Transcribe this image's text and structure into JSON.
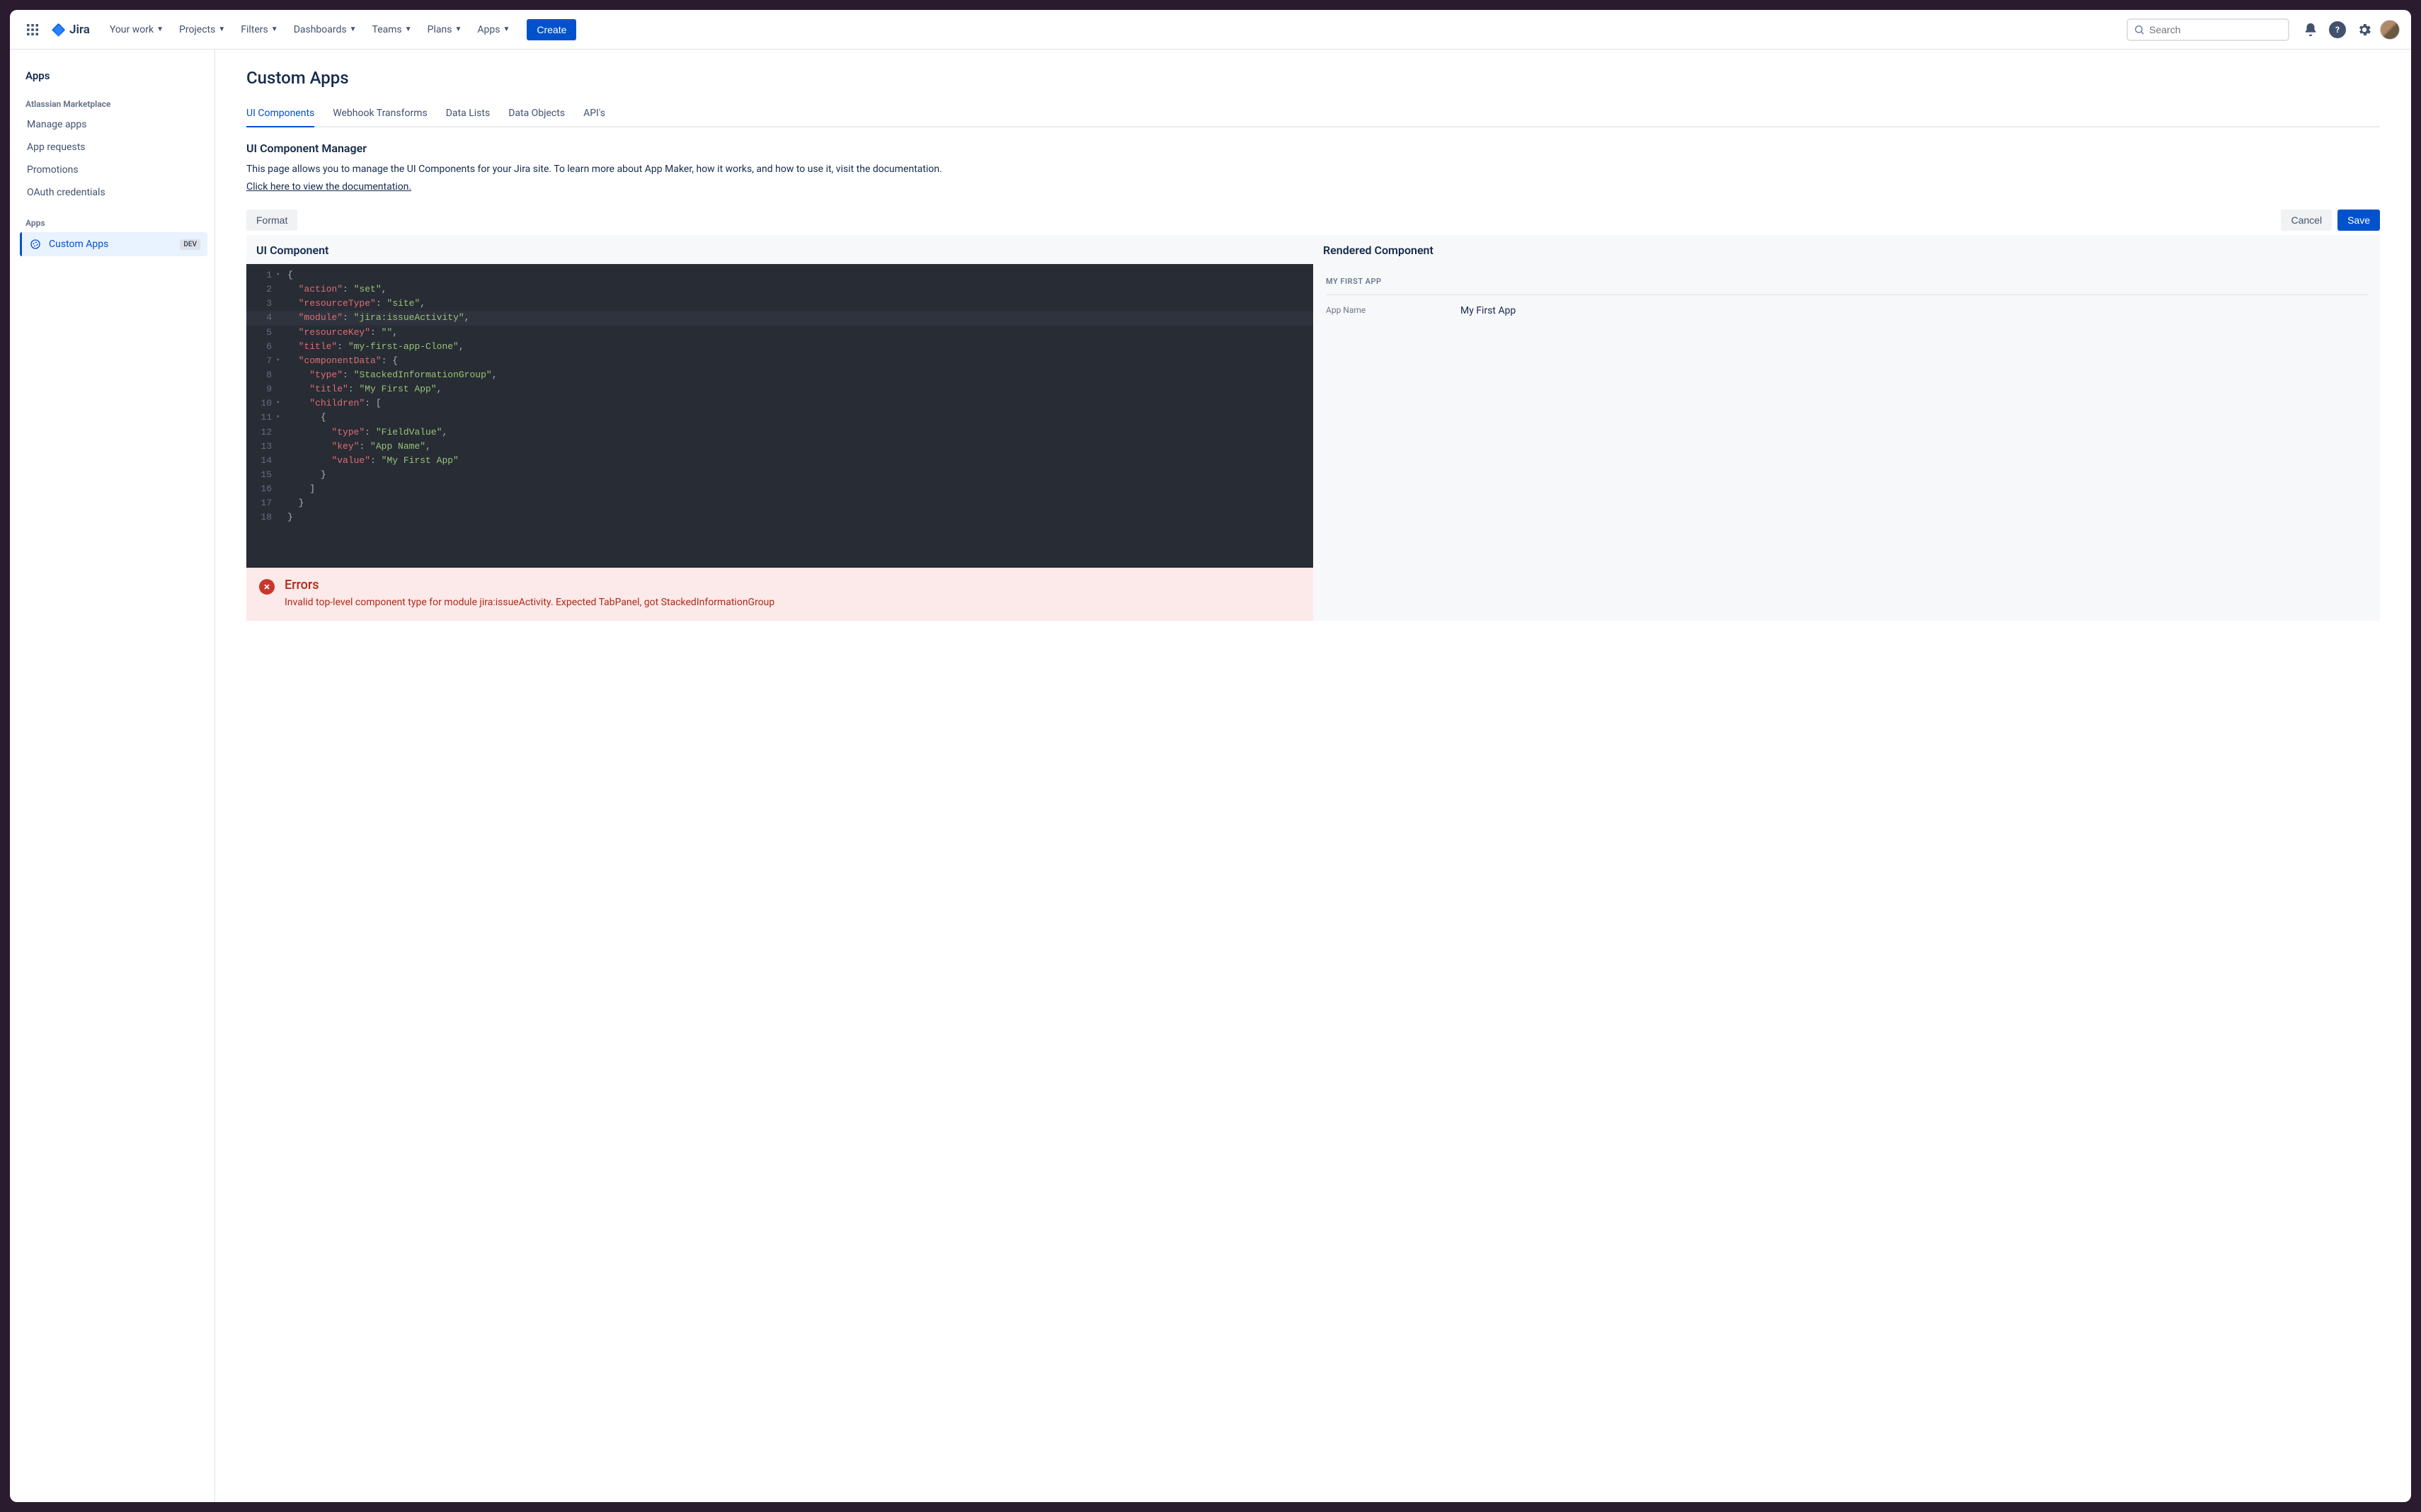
{
  "topnav": {
    "logo_text": "Jira",
    "items": [
      {
        "label": "Your work"
      },
      {
        "label": "Projects"
      },
      {
        "label": "Filters"
      },
      {
        "label": "Dashboards"
      },
      {
        "label": "Teams"
      },
      {
        "label": "Plans"
      },
      {
        "label": "Apps"
      }
    ],
    "create_label": "Create",
    "search_placeholder": "Search"
  },
  "sidebar": {
    "title": "Apps",
    "section1_label": "Atlassian Marketplace",
    "section1_items": [
      {
        "label": "Manage apps"
      },
      {
        "label": "App requests"
      },
      {
        "label": "Promotions"
      },
      {
        "label": "OAuth credentials"
      }
    ],
    "section2_label": "Apps",
    "active_item_label": "Custom Apps",
    "active_item_badge": "DEV"
  },
  "page": {
    "title": "Custom Apps",
    "tabs": [
      {
        "label": "UI Components",
        "active": true
      },
      {
        "label": "Webhook Transforms"
      },
      {
        "label": "Data Lists"
      },
      {
        "label": "Data Objects"
      },
      {
        "label": "API's"
      }
    ],
    "section_heading": "UI Component Manager",
    "description": "This page allows you to manage the UI Components for your Jira site. To learn more about App Maker, how it works, and how to use it, visit the documentation.",
    "doc_link_text": "Click here to view the documentation."
  },
  "toolbar": {
    "format_label": "Format",
    "cancel_label": "Cancel",
    "save_label": "Save"
  },
  "editor": {
    "panel_title": "UI Component",
    "code": {
      "action": "set",
      "resourceType": "site",
      "module": "jira:issueActivity",
      "resourceKey": "",
      "title": "my-first-app-Clone",
      "componentData": {
        "type": "StackedInformationGroup",
        "title": "My First App",
        "children": [
          {
            "type": "FieldValue",
            "key": "App Name",
            "value": "My First App"
          }
        ]
      }
    },
    "lines": [
      {
        "n": 1,
        "fold": true,
        "indent": 0,
        "tokens": [
          [
            "punc",
            "{"
          ]
        ]
      },
      {
        "n": 2,
        "fold": false,
        "indent": 1,
        "tokens": [
          [
            "key",
            "\"action\""
          ],
          [
            "punc",
            ": "
          ],
          [
            "str",
            "\"set\""
          ],
          [
            "punc",
            ","
          ]
        ]
      },
      {
        "n": 3,
        "fold": false,
        "indent": 1,
        "tokens": [
          [
            "key",
            "\"resourceType\""
          ],
          [
            "punc",
            ": "
          ],
          [
            "str",
            "\"site\""
          ],
          [
            "punc",
            ","
          ]
        ]
      },
      {
        "n": 4,
        "fold": false,
        "indent": 1,
        "hl": true,
        "tokens": [
          [
            "key",
            "\"module\""
          ],
          [
            "punc",
            ": "
          ],
          [
            "str",
            "\"jira:issueActivity\""
          ],
          [
            "punc",
            ","
          ]
        ]
      },
      {
        "n": 5,
        "fold": false,
        "indent": 1,
        "tokens": [
          [
            "key",
            "\"resourceKey\""
          ],
          [
            "punc",
            ": "
          ],
          [
            "str",
            "\"\""
          ],
          [
            "punc",
            ","
          ]
        ]
      },
      {
        "n": 6,
        "fold": false,
        "indent": 1,
        "tokens": [
          [
            "key",
            "\"title\""
          ],
          [
            "punc",
            ": "
          ],
          [
            "str",
            "\"my-first-app-Clone\""
          ],
          [
            "punc",
            ","
          ]
        ]
      },
      {
        "n": 7,
        "fold": true,
        "indent": 1,
        "tokens": [
          [
            "key",
            "\"componentData\""
          ],
          [
            "punc",
            ": {"
          ]
        ]
      },
      {
        "n": 8,
        "fold": false,
        "indent": 2,
        "tokens": [
          [
            "key",
            "\"type\""
          ],
          [
            "punc",
            ": "
          ],
          [
            "str",
            "\"StackedInformationGroup\""
          ],
          [
            "punc",
            ","
          ]
        ]
      },
      {
        "n": 9,
        "fold": false,
        "indent": 2,
        "tokens": [
          [
            "key",
            "\"title\""
          ],
          [
            "punc",
            ": "
          ],
          [
            "str",
            "\"My First App\""
          ],
          [
            "punc",
            ","
          ]
        ]
      },
      {
        "n": 10,
        "fold": true,
        "indent": 2,
        "tokens": [
          [
            "key",
            "\"children\""
          ],
          [
            "punc",
            ": ["
          ]
        ]
      },
      {
        "n": 11,
        "fold": true,
        "indent": 3,
        "tokens": [
          [
            "punc",
            "{"
          ]
        ]
      },
      {
        "n": 12,
        "fold": false,
        "indent": 4,
        "tokens": [
          [
            "key",
            "\"type\""
          ],
          [
            "punc",
            ": "
          ],
          [
            "str",
            "\"FieldValue\""
          ],
          [
            "punc",
            ","
          ]
        ]
      },
      {
        "n": 13,
        "fold": false,
        "indent": 4,
        "tokens": [
          [
            "key",
            "\"key\""
          ],
          [
            "punc",
            ": "
          ],
          [
            "str",
            "\"App Name\""
          ],
          [
            "punc",
            ","
          ]
        ]
      },
      {
        "n": 14,
        "fold": false,
        "indent": 4,
        "tokens": [
          [
            "key",
            "\"value\""
          ],
          [
            "punc",
            ": "
          ],
          [
            "str",
            "\"My First App\""
          ]
        ]
      },
      {
        "n": 15,
        "fold": false,
        "indent": 3,
        "tokens": [
          [
            "punc",
            "}"
          ]
        ]
      },
      {
        "n": 16,
        "fold": false,
        "indent": 2,
        "tokens": [
          [
            "punc",
            "]"
          ]
        ]
      },
      {
        "n": 17,
        "fold": false,
        "indent": 1,
        "tokens": [
          [
            "punc",
            "}"
          ]
        ]
      },
      {
        "n": 18,
        "fold": false,
        "indent": 0,
        "tokens": [
          [
            "punc",
            "}"
          ]
        ]
      }
    ]
  },
  "errors": {
    "title": "Errors",
    "message": "Invalid top-level component type for module jira:issueActivity. Expected TabPanel, got StackedInformationGroup"
  },
  "rendered": {
    "panel_title": "Rendered Component",
    "group_label": "MY FIRST APP",
    "field_label": "App Name",
    "field_value": "My First App"
  }
}
